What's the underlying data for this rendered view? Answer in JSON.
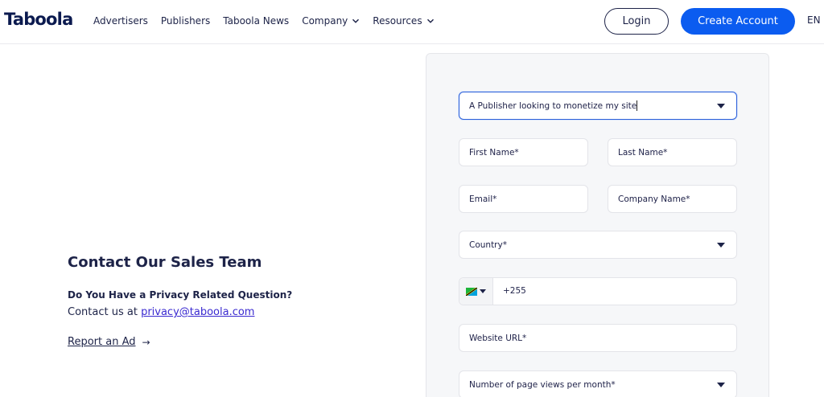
{
  "header": {
    "logo": "Taboola",
    "nav": [
      "Advertisers",
      "Publishers",
      "Taboola News",
      "Company",
      "Resources"
    ],
    "login": "Login",
    "create_account": "Create Account",
    "language": "EN"
  },
  "contact": {
    "title": "Contact Our Sales Team",
    "privacy_question": "Do You Have a Privacy Related Question?",
    "contact_prefix": "Contact us at ",
    "email": "privacy@taboola.com",
    "report_ad": "Report an Ad",
    "report_arrow": "→"
  },
  "form": {
    "role_select": "A Publisher looking to monetize my site",
    "first_name": "First Name*",
    "last_name": "Last Name*",
    "email": "Email*",
    "company_name": "Company Name*",
    "country": "Country*",
    "phone_value": "+255",
    "website_url": "Website URL*",
    "page_views": "Number of page views per month*"
  },
  "colors": {
    "accent": "#0b5cf0",
    "text": "#1d2348"
  },
  "icons": {
    "nav_dropdown": "chevron-down-icon",
    "select_caret": "caret-down-icon",
    "flag": "tanzania-flag-icon",
    "report_arrow": "arrow-right-icon"
  }
}
